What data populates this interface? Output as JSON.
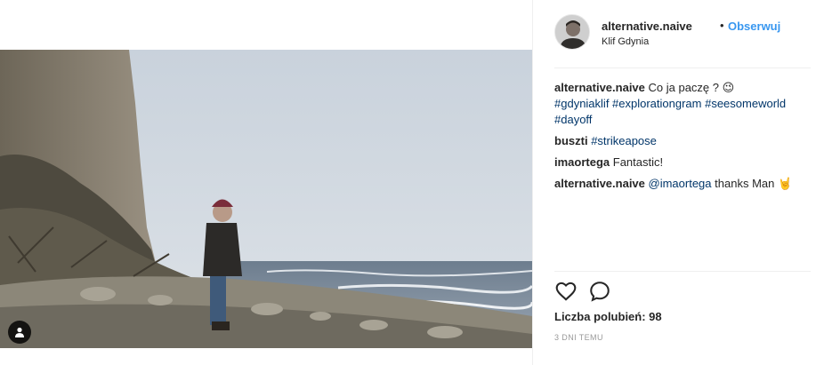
{
  "post": {
    "username": "alternative.naive",
    "separator": "•",
    "follow_label": "Obserwuj",
    "location": "Klif Gdynia"
  },
  "comments": [
    {
      "user": "alternative.naive",
      "text": "Co ja paczę ? 😉",
      "hashtags": "#gdyniaklif #explorationgram #seesomeworld #dayoff"
    },
    {
      "user": "buszti",
      "hashtags": "#strikeapose"
    },
    {
      "user": "imaortega",
      "text": "Fantastic!"
    },
    {
      "user": "alternative.naive",
      "mention": "@imaortega",
      "text": "thanks Man 🤘"
    }
  ],
  "likes": {
    "label": "Liczba polubień: 98"
  },
  "timestamp": "3 dni temu",
  "icons": {
    "like": "heart-icon",
    "comment": "comment-icon",
    "tag": "user-tag-icon"
  },
  "colors": {
    "link_blue": "#3897f0",
    "hashtag": "#003569",
    "text": "#262626",
    "muted": "#999999"
  }
}
